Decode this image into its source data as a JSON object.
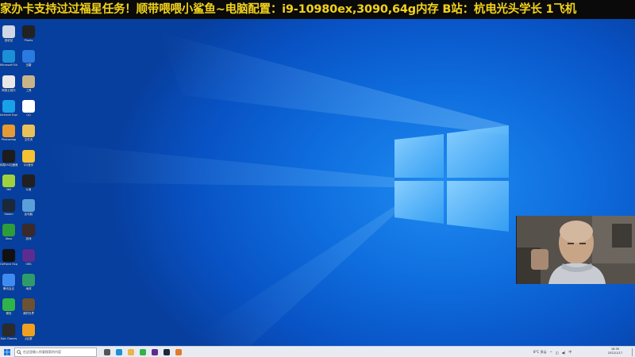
{
  "ticker": {
    "text": "家办卡支持过过福星任务！顺带喂喂小鲨鱼~电脑配置：i9-10980ex,3090,64g内存 B站：杭电光头学长   1飞机"
  },
  "desktop_icons": [
    {
      "label": "回收站",
      "icon": "recycle-bin-icon",
      "color": "#cfd8e4"
    },
    {
      "label": "Plants",
      "icon": "app-icon",
      "color": "#222222"
    },
    {
      "label": "Microsoft Edge",
      "icon": "edge-icon",
      "color": "#1b8fd8"
    },
    {
      "label": "迅雷",
      "icon": "thunder-icon",
      "color": "#2a7ae0"
    },
    {
      "label": "网易云音乐",
      "icon": "music-icon",
      "color": "#e8e8e8"
    },
    {
      "label": "工具",
      "icon": "gear-icon",
      "color": "#c9b48a"
    },
    {
      "label": "Internet Explorer",
      "icon": "ie-icon",
      "color": "#1aa0e6"
    },
    {
      "label": "QQ",
      "icon": "qq-icon",
      "color": "#ffffff"
    },
    {
      "label": "Photoshop",
      "icon": "ps-icon",
      "color": "#e59a34"
    },
    {
      "label": "文件夹",
      "icon": "folder-icon",
      "color": "#e8c15a"
    },
    {
      "label": "网易UU加速器",
      "icon": "uu-icon",
      "color": "#1c1c1c"
    },
    {
      "label": "QQ音乐",
      "icon": "qqmusic-icon",
      "color": "#f5c233"
    },
    {
      "label": "360",
      "icon": "360-icon",
      "color": "#9ed13d"
    },
    {
      "label": "斗鱼",
      "icon": "douyu-icon",
      "color": "#202020"
    },
    {
      "label": "Steam",
      "icon": "steam-icon",
      "color": "#1b2838"
    },
    {
      "label": "此电脑",
      "icon": "computer-icon",
      "color": "#5aa0d8"
    },
    {
      "label": "Xbox",
      "icon": "xbox-icon",
      "color": "#2d9c3a"
    },
    {
      "label": "游戏",
      "icon": "game-icon",
      "color": "#3a2a2a"
    },
    {
      "label": "GeForce Experience",
      "icon": "nvidia-icon",
      "color": "#111111"
    },
    {
      "label": "OBS",
      "icon": "obs-icon",
      "color": "#5c2d91"
    },
    {
      "label": "腾讯会议",
      "icon": "meeting-icon",
      "color": "#3f8cf0"
    },
    {
      "label": "地球",
      "icon": "globe-icon",
      "color": "#2e9c6a"
    },
    {
      "label": "微信",
      "icon": "wechat-icon",
      "color": "#2fb44a"
    },
    {
      "label": "我的世界",
      "icon": "minecraft-icon",
      "color": "#6b5232"
    },
    {
      "label": "Epic Games",
      "icon": "epic-icon",
      "color": "#2b2b2b"
    },
    {
      "label": "JJ比赛",
      "icon": "jj-icon",
      "color": "#f0a020"
    }
  ],
  "taskbar": {
    "search_placeholder": "在这里输入你要搜索的内容",
    "apps": [
      {
        "name": "task-view-icon",
        "color": "#555"
      },
      {
        "name": "edge-taskbar-icon",
        "color": "#1b8fd8"
      },
      {
        "name": "explorer-taskbar-icon",
        "color": "#e8b64a"
      },
      {
        "name": "wechat-taskbar-icon",
        "color": "#2fb44a"
      },
      {
        "name": "obs-taskbar-icon",
        "color": "#5c2d91"
      },
      {
        "name": "steam-taskbar-icon",
        "color": "#1b2838"
      },
      {
        "name": "game-taskbar-icon",
        "color": "#e07a2a"
      }
    ],
    "weather": "8°C 多云",
    "time": "18:30",
    "date": "2022/1/17"
  }
}
